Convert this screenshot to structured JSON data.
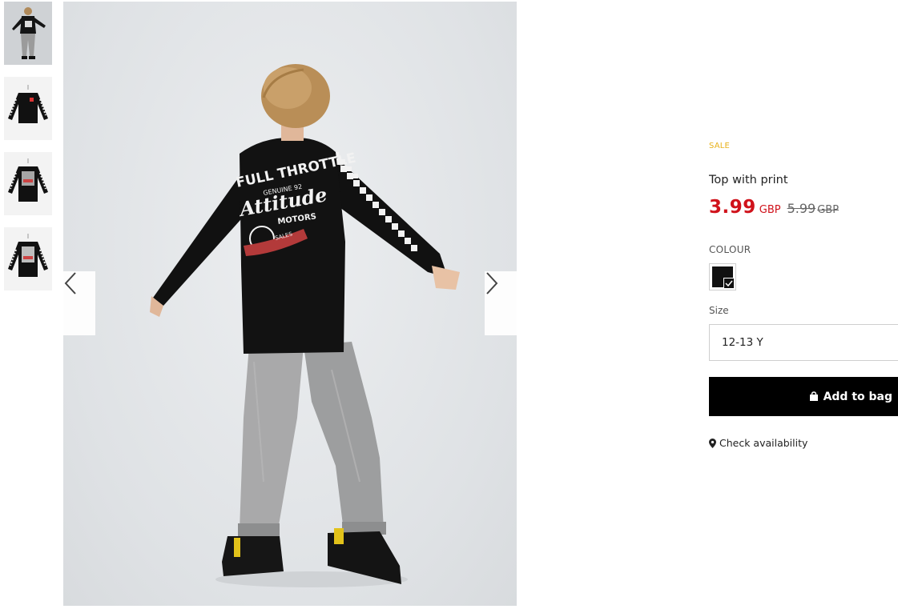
{
  "gallery": {
    "thumbnails": [
      {
        "name": "thumbnail-1",
        "active": true
      },
      {
        "name": "thumbnail-2",
        "active": false
      },
      {
        "name": "thumbnail-3",
        "active": false
      },
      {
        "name": "thumbnail-4",
        "active": false
      }
    ],
    "print_text": {
      "line1": "FULL THROTTLE",
      "line2": "GENUINE 92",
      "line3": "Attitude",
      "line4": "MOTORS",
      "line5": "SALES"
    },
    "prev_icon": "chevron-left-icon",
    "next_icon": "chevron-right-icon"
  },
  "product": {
    "badge": "SALE",
    "title": "Top with print",
    "price": "3.99",
    "currency": "GBP",
    "old_price": "5.99",
    "old_currency": "GBP",
    "colour_label": "COLOUR",
    "size_label": "Size",
    "selected_size": "12-13 Y",
    "add_to_bag": "Add to bag",
    "check_availability": "Check availability"
  },
  "colors": {
    "sale": "#e8b21b",
    "price": "#d0121b",
    "button": "#000000",
    "swatch": "#111111"
  }
}
